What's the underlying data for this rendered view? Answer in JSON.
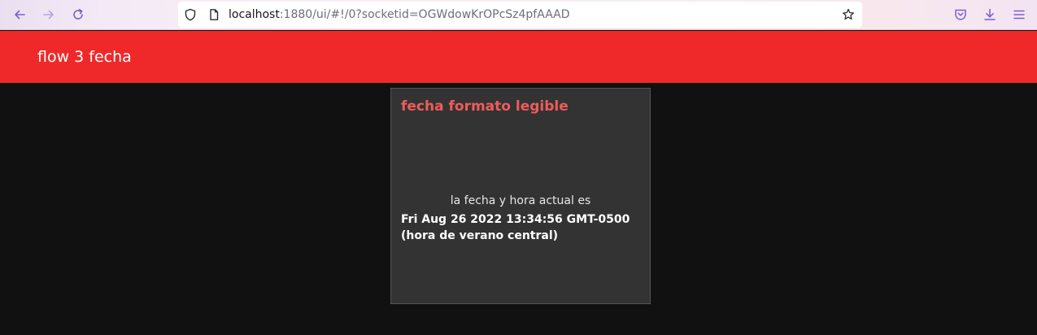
{
  "browser": {
    "url_host": "localhost",
    "url_rest": ":1880/ui/#!/0?socketid=OGWdowKrOPcSz4pfAAAD",
    "icons": [
      "back-arrow-icon",
      "forward-arrow-icon",
      "reload-icon",
      "shield-icon",
      "page-icon",
      "bookmark-star-icon",
      "pocket-icon",
      "download-icon",
      "menu-icon"
    ]
  },
  "header": {
    "title": "flow 3 fecha",
    "color": "#ef2929"
  },
  "card": {
    "title": "fecha formato legible",
    "label": "la fecha y hora actual es",
    "value": "Fri Aug 26 2022 13:34:56 GMT-0500 (hora de verano central)",
    "title_color": "#ef5b5b"
  }
}
